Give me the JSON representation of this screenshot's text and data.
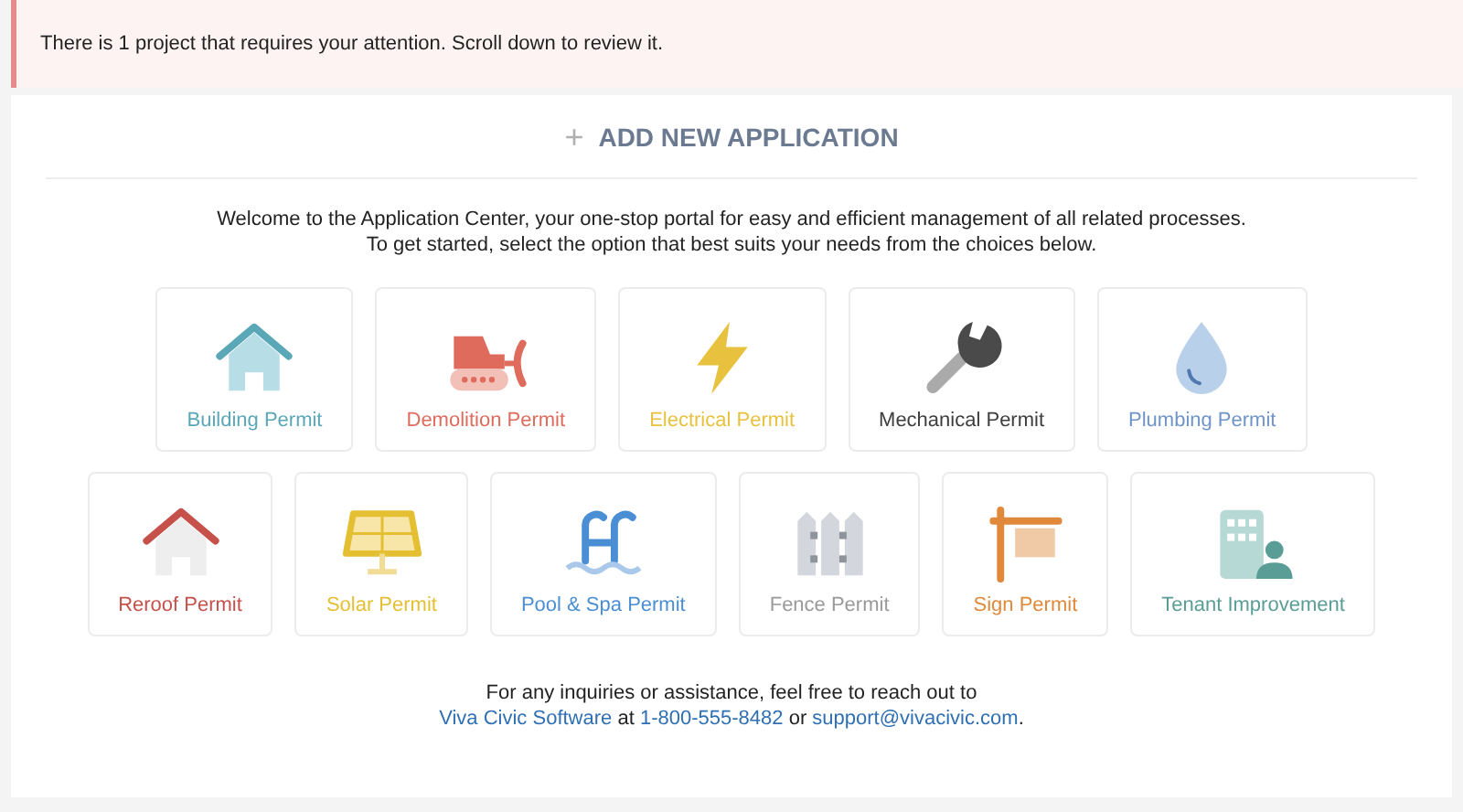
{
  "alert": {
    "text": "There is 1 project that requires your attention. Scroll down to review it."
  },
  "add_button": {
    "icon": "+",
    "label": "ADD NEW APPLICATION"
  },
  "intro": [
    "Welcome to the Application Center, your one-stop portal for easy and efficient management of all related processes.",
    "To get started, select the option that best suits your needs from the choices below."
  ],
  "rows": [
    [
      {
        "kind": "house",
        "label": "Building Permit",
        "color": "#5aa7b7"
      },
      {
        "kind": "bulldozer",
        "label": "Demolition Permit",
        "color": "#df6b5d"
      },
      {
        "kind": "bolt",
        "label": "Electrical Permit",
        "color": "#e8c23e"
      },
      {
        "kind": "wrench",
        "label": "Mechanical Permit",
        "color": "#3d3d3d"
      },
      {
        "kind": "drop",
        "label": "Plumbing Permit",
        "color": "#6f94c8"
      }
    ],
    [
      {
        "kind": "roof",
        "label": "Reroof Permit",
        "color": "#c6504a"
      },
      {
        "kind": "solar",
        "label": "Solar Permit",
        "color": "#e4bf31"
      },
      {
        "kind": "pool",
        "label": "Pool & Spa Permit",
        "color": "#4a8ed3"
      },
      {
        "kind": "fence",
        "label": "Fence Permit",
        "color": "#999999"
      },
      {
        "kind": "sign",
        "label": "Sign Permit",
        "color": "#e0893b"
      },
      {
        "kind": "tenant",
        "label": "Tenant Improvement",
        "color": "#5a9d97"
      }
    ]
  ],
  "footer": {
    "line1": "For any inquiries or assistance, feel free to reach out to",
    "company": "Viva Civic Software",
    "at": "at",
    "phone": "1-800-555-8482",
    "or": "or",
    "email": "support@vivacivic.com",
    "end": "."
  }
}
